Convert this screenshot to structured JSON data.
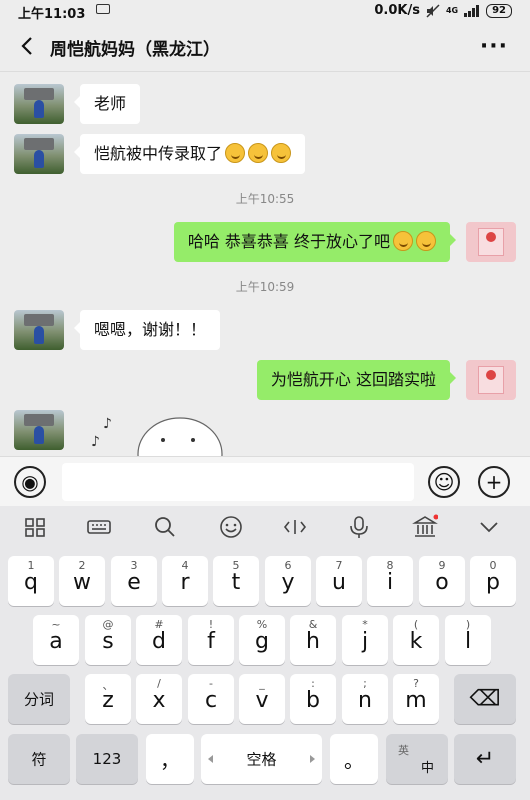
{
  "status_bar": {
    "time": "上午11:03",
    "network_speed": "0.0K/s",
    "network_type": "4G",
    "battery": "92"
  },
  "header": {
    "back_icon": "chevron-left-icon",
    "title": "周恺航妈妈（黑龙江）",
    "more_icon": "more-dots-icon",
    "more_glyph": "···"
  },
  "messages": [
    {
      "side": "left",
      "text": "老师",
      "emoji_count": 0
    },
    {
      "side": "left",
      "text": "恺航被中传录取了",
      "emoji_count": 3
    },
    {
      "timestamp": "上午10:55"
    },
    {
      "side": "right",
      "text": "哈哈 恭喜恭喜 终于放心了吧",
      "emoji_count": 2
    },
    {
      "timestamp": "上午10:59"
    },
    {
      "side": "left",
      "text": "嗯嗯，谢谢！！",
      "emoji_count": 0
    },
    {
      "side": "right",
      "text": "为恺航开心 这回踏实啦",
      "emoji_count": 0
    },
    {
      "side": "left",
      "type": "sticker"
    }
  ],
  "input_bar": {
    "voice_icon": "voice-icon",
    "emoji_icon": "smiley-icon",
    "plus_icon": "plus-icon",
    "voice_glyph": "◉",
    "emoji_glyph": "☺",
    "plus_glyph": "+"
  },
  "toolbar": [
    "grid-icon",
    "keyboard-icon",
    "search-icon",
    "emoji-icon",
    "cursor-icon",
    "voice-input-icon",
    "theme-icon",
    "chevron-down-icon"
  ],
  "keyboard": {
    "row1": [
      {
        "sub": "1",
        "main": "q"
      },
      {
        "sub": "2",
        "main": "w"
      },
      {
        "sub": "3",
        "main": "e"
      },
      {
        "sub": "4",
        "main": "r"
      },
      {
        "sub": "5",
        "main": "t"
      },
      {
        "sub": "6",
        "main": "y"
      },
      {
        "sub": "7",
        "main": "u"
      },
      {
        "sub": "8",
        "main": "i"
      },
      {
        "sub": "9",
        "main": "o"
      },
      {
        "sub": "0",
        "main": "p"
      }
    ],
    "row2": [
      {
        "sub": "~",
        "main": "a"
      },
      {
        "sub": "@",
        "main": "s"
      },
      {
        "sub": "#",
        "main": "d"
      },
      {
        "sub": "!",
        "main": "f"
      },
      {
        "sub": "%",
        "main": "g"
      },
      {
        "sub": "&",
        "main": "h"
      },
      {
        "sub": "*",
        "main": "j"
      },
      {
        "sub": "(",
        "main": "k"
      },
      {
        "sub": ")",
        "main": "l"
      }
    ],
    "row3": [
      {
        "sub": "、",
        "main": "z"
      },
      {
        "sub": "/",
        "main": "x"
      },
      {
        "sub": "-",
        "main": "c"
      },
      {
        "sub": "_",
        "main": "v"
      },
      {
        "sub": ":",
        "main": "b"
      },
      {
        "sub": ";",
        "main": "n"
      },
      {
        "sub": "?",
        "main": "m"
      }
    ],
    "fenci": "分词",
    "delete_glyph": "⌫",
    "fu": "符",
    "num": "123",
    "comma": "，",
    "space": "空格",
    "period": "。",
    "lang_top": "英",
    "lang_bottom": "中",
    "enter_glyph": "↵"
  }
}
